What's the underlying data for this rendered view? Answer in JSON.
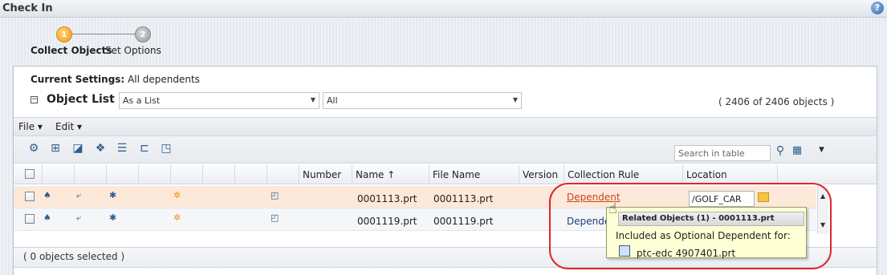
{
  "window": {
    "title": "Check In"
  },
  "wizard": {
    "steps": [
      {
        "number": "1",
        "label": "Collect Objects"
      },
      {
        "number": "2",
        "label": "Set Options"
      }
    ]
  },
  "settings": {
    "label": "Current Settings:",
    "value": "All dependents"
  },
  "object_list": {
    "title": "Object List",
    "view_dropdown": "As a List",
    "filter_dropdown": "All",
    "count_text": "( 2406 of 2406 objects )"
  },
  "menus": {
    "file": "File ▾",
    "edit": "Edit ▾"
  },
  "search": {
    "placeholder": "Search in table"
  },
  "columns": {
    "number": "Number",
    "name": "Name ↑",
    "file_name": "File Name",
    "version": "Version",
    "collection_rule": "Collection Rule",
    "location": "Location"
  },
  "rows": [
    {
      "name": "0001113.prt",
      "file_name": "0001113.prt",
      "collection_rule": "Dependent",
      "location": "/GOLF_CAR"
    },
    {
      "name": "0001119.prt",
      "file_name": "0001119.prt",
      "collection_rule": "Depende"
    }
  ],
  "footer": {
    "selected_text": "( 0 objects selected )"
  },
  "tooltip": {
    "header": "Related Objects (1) - ",
    "header_object": "0001113.prt",
    "line": "Included as Optional Dependent for:",
    "object": "ptc-edc 4907401.prt"
  },
  "icons": {
    "help": "help-icon",
    "search": "search-icon",
    "folder": "folder-icon",
    "collapse": "collapse-icon",
    "tooltip_object": "part-icon"
  },
  "colors": {
    "accent_orange": "#f39a18",
    "link_red": "#c8441a",
    "highlight_red": "#e0262c",
    "row_highlight": "#fde9d9"
  }
}
